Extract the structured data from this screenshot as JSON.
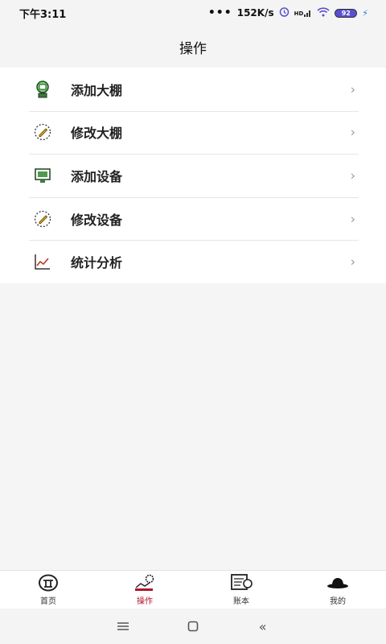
{
  "status_bar": {
    "time": "下午3:11",
    "network_speed": "152K/s",
    "signal_label": "HD",
    "battery": "92"
  },
  "header": {
    "title": "操作"
  },
  "menu": {
    "items": [
      {
        "label": "添加大棚",
        "icon": "add-greenhouse-icon"
      },
      {
        "label": "修改大棚",
        "icon": "edit-pencil-icon"
      },
      {
        "label": "添加设备",
        "icon": "add-device-icon"
      },
      {
        "label": "修改设备",
        "icon": "edit-pencil-icon"
      },
      {
        "label": "统计分析",
        "icon": "chart-line-icon"
      }
    ],
    "chevron": "›"
  },
  "tab_bar": {
    "tabs": [
      {
        "label": "首页",
        "icon": "home-icon",
        "active": false
      },
      {
        "label": "操作",
        "icon": "operation-gear-icon",
        "active": true
      },
      {
        "label": "账本",
        "icon": "ledger-icon",
        "active": false
      },
      {
        "label": "我的",
        "icon": "hat-icon",
        "active": false
      }
    ],
    "active_color": "#b0152c"
  },
  "nav_bar": {
    "buttons": [
      "menu-icon",
      "home-square-icon",
      "back-icon"
    ],
    "back_glyph": "«"
  }
}
